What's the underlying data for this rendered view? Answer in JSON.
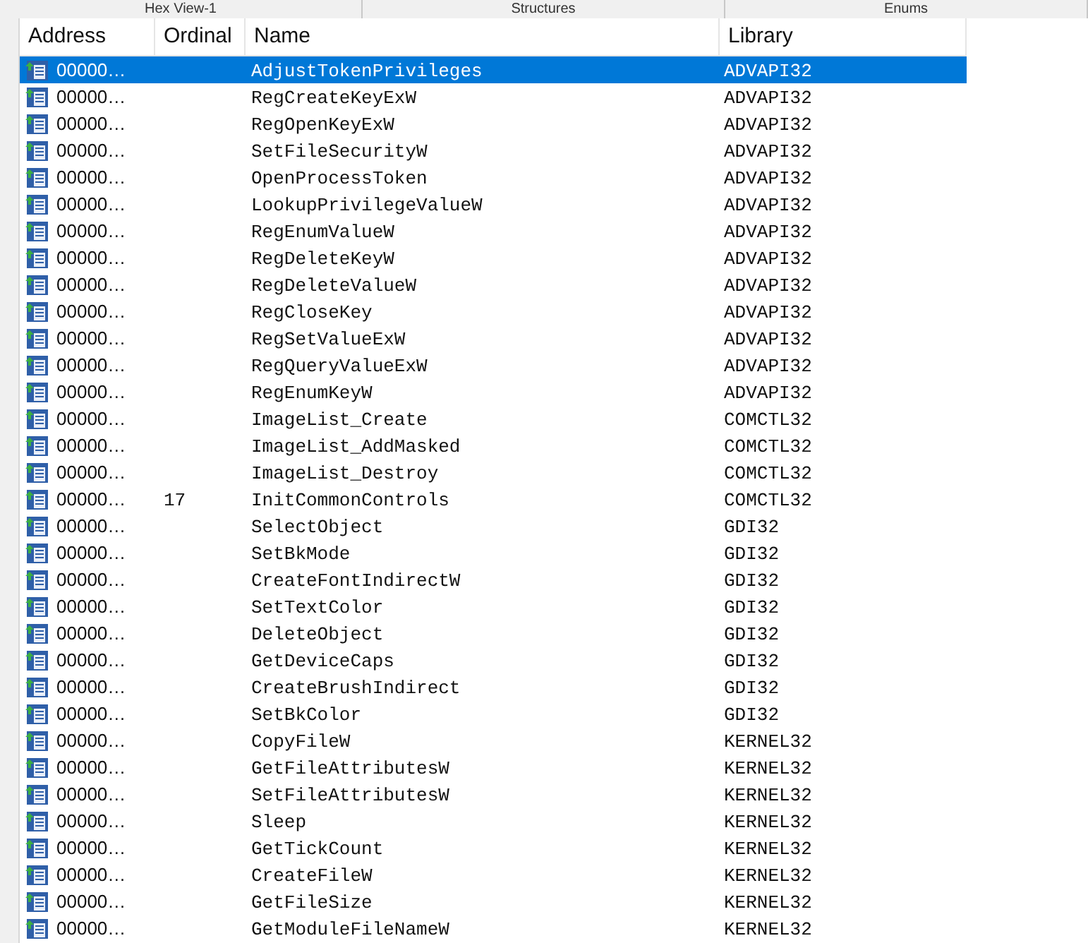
{
  "tabs": [
    {
      "label": "Hex View-1",
      "selected": false
    },
    {
      "label": "Structures",
      "selected": false
    },
    {
      "label": "Enums",
      "selected": false
    }
  ],
  "table": {
    "columns": [
      "Address",
      "Ordinal",
      "Name",
      "Library"
    ],
    "rows": [
      {
        "address": "00000…",
        "ordinal": "",
        "name": "AdjustTokenPrivileges",
        "library": "ADVAPI32",
        "selected": true
      },
      {
        "address": "00000…",
        "ordinal": "",
        "name": "RegCreateKeyExW",
        "library": "ADVAPI32",
        "selected": false
      },
      {
        "address": "00000…",
        "ordinal": "",
        "name": "RegOpenKeyExW",
        "library": "ADVAPI32",
        "selected": false
      },
      {
        "address": "00000…",
        "ordinal": "",
        "name": "SetFileSecurityW",
        "library": "ADVAPI32",
        "selected": false
      },
      {
        "address": "00000…",
        "ordinal": "",
        "name": "OpenProcessToken",
        "library": "ADVAPI32",
        "selected": false
      },
      {
        "address": "00000…",
        "ordinal": "",
        "name": "LookupPrivilegeValueW",
        "library": "ADVAPI32",
        "selected": false
      },
      {
        "address": "00000…",
        "ordinal": "",
        "name": "RegEnumValueW",
        "library": "ADVAPI32",
        "selected": false
      },
      {
        "address": "00000…",
        "ordinal": "",
        "name": "RegDeleteKeyW",
        "library": "ADVAPI32",
        "selected": false
      },
      {
        "address": "00000…",
        "ordinal": "",
        "name": "RegDeleteValueW",
        "library": "ADVAPI32",
        "selected": false
      },
      {
        "address": "00000…",
        "ordinal": "",
        "name": "RegCloseKey",
        "library": "ADVAPI32",
        "selected": false
      },
      {
        "address": "00000…",
        "ordinal": "",
        "name": "RegSetValueExW",
        "library": "ADVAPI32",
        "selected": false
      },
      {
        "address": "00000…",
        "ordinal": "",
        "name": "RegQueryValueExW",
        "library": "ADVAPI32",
        "selected": false
      },
      {
        "address": "00000…",
        "ordinal": "",
        "name": "RegEnumKeyW",
        "library": "ADVAPI32",
        "selected": false
      },
      {
        "address": "00000…",
        "ordinal": "",
        "name": "ImageList_Create",
        "library": "COMCTL32",
        "selected": false
      },
      {
        "address": "00000…",
        "ordinal": "",
        "name": "ImageList_AddMasked",
        "library": "COMCTL32",
        "selected": false
      },
      {
        "address": "00000…",
        "ordinal": "",
        "name": "ImageList_Destroy",
        "library": "COMCTL32",
        "selected": false
      },
      {
        "address": "00000…",
        "ordinal": "17",
        "name": "InitCommonControls",
        "library": "COMCTL32",
        "selected": false
      },
      {
        "address": "00000…",
        "ordinal": "",
        "name": "SelectObject",
        "library": "GDI32",
        "selected": false
      },
      {
        "address": "00000…",
        "ordinal": "",
        "name": "SetBkMode",
        "library": "GDI32",
        "selected": false
      },
      {
        "address": "00000…",
        "ordinal": "",
        "name": "CreateFontIndirectW",
        "library": "GDI32",
        "selected": false
      },
      {
        "address": "00000…",
        "ordinal": "",
        "name": "SetTextColor",
        "library": "GDI32",
        "selected": false
      },
      {
        "address": "00000…",
        "ordinal": "",
        "name": "DeleteObject",
        "library": "GDI32",
        "selected": false
      },
      {
        "address": "00000…",
        "ordinal": "",
        "name": "GetDeviceCaps",
        "library": "GDI32",
        "selected": false
      },
      {
        "address": "00000…",
        "ordinal": "",
        "name": "CreateBrushIndirect",
        "library": "GDI32",
        "selected": false
      },
      {
        "address": "00000…",
        "ordinal": "",
        "name": "SetBkColor",
        "library": "GDI32",
        "selected": false
      },
      {
        "address": "00000…",
        "ordinal": "",
        "name": "CopyFileW",
        "library": "KERNEL32",
        "selected": false
      },
      {
        "address": "00000…",
        "ordinal": "",
        "name": "GetFileAttributesW",
        "library": "KERNEL32",
        "selected": false
      },
      {
        "address": "00000…",
        "ordinal": "",
        "name": "SetFileAttributesW",
        "library": "KERNEL32",
        "selected": false
      },
      {
        "address": "00000…",
        "ordinal": "",
        "name": "Sleep",
        "library": "KERNEL32",
        "selected": false
      },
      {
        "address": "00000…",
        "ordinal": "",
        "name": "GetTickCount",
        "library": "KERNEL32",
        "selected": false
      },
      {
        "address": "00000…",
        "ordinal": "",
        "name": "CreateFileW",
        "library": "KERNEL32",
        "selected": false
      },
      {
        "address": "00000…",
        "ordinal": "",
        "name": "GetFileSize",
        "library": "KERNEL32",
        "selected": false
      },
      {
        "address": "00000…",
        "ordinal": "",
        "name": "GetModuleFileNameW",
        "library": "KERNEL32",
        "selected": false
      }
    ]
  }
}
